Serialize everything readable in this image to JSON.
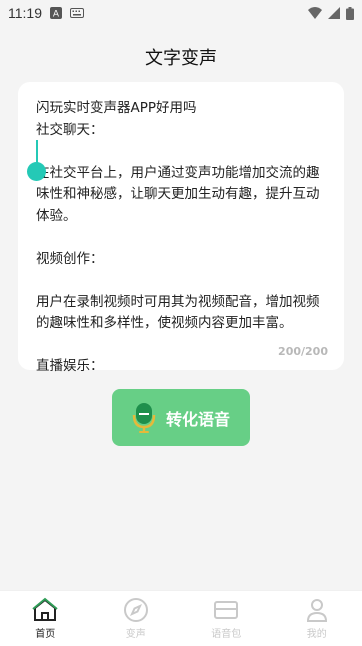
{
  "status": {
    "time": "11:19"
  },
  "header": {
    "title": "文字变声"
  },
  "editor": {
    "lines": [
      "闪玩实时变声器APP好用吗",
      "社交聊天：",
      "",
      "在社交平台上，用户通过变声功能增加交流的趣味性和神秘感，让聊天更加生动有趣，提升互动体验。",
      "",
      "视频创作：",
      "",
      "用户在录制视频时可用其为视频配音，增加视频的趣味性和多样性，使视频内容更加丰富。",
      "",
      "直播娱乐："
    ],
    "counter": "200/200"
  },
  "action": {
    "convert_label": "转化语音"
  },
  "nav": {
    "items": [
      {
        "label": "首页",
        "icon": "home-icon"
      },
      {
        "label": "变声",
        "icon": "compass-icon"
      },
      {
        "label": "语音包",
        "icon": "voice-pack-icon"
      },
      {
        "label": "我的",
        "icon": "user-icon"
      }
    ],
    "active_color": "#222222",
    "inactive_color": "#c9c9c9"
  },
  "colors": {
    "accent": "#67cf86",
    "cursor": "#24c9b6"
  }
}
